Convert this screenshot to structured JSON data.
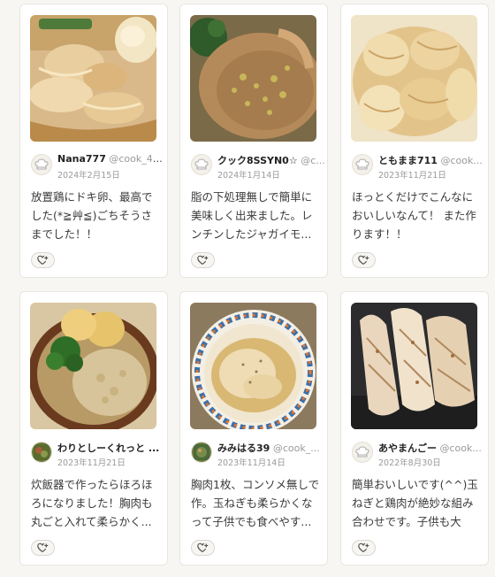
{
  "cards": [
    {
      "author": "Nana777",
      "cook_id": "@cook_40...",
      "date": "2024年2月15日",
      "comment": "放置鶏にドキ卵、最高でした(*≧艸≦)ごちそうさまでした！！",
      "avatar_icon": "chef-hat-icon",
      "photo": "chicken-with-egg"
    },
    {
      "author": "クック8SSYN0☆",
      "cook_id": "@c...",
      "date": "2024年1月14日",
      "comment": "脂の下処理無しで簡単に美味しく出来ました。レンチンしたジャガイモ...",
      "avatar_icon": "chef-hat-icon",
      "photo": "chicken-with-onion-sauce"
    },
    {
      "author": "ともまま711",
      "cook_id": "@cook...",
      "date": "2023年11月21日",
      "comment": "ほっとくだけでこんなにおいしいなんて！ また作ります！！",
      "avatar_icon": "chef-hat-icon",
      "photo": "sliced-chicken"
    },
    {
      "author": "わりとしーくれっと ...",
      "cook_id": "",
      "date": "2023年11月21日",
      "comment": "炊飯器で作ったらほろほろになりました！胸肉も丸ごと入れて柔らかく...",
      "avatar_icon": "user-photo-icon",
      "photo": "chicken-bowl-broccoli"
    },
    {
      "author": "みみはる39",
      "cook_id": "@cook_...",
      "date": "2023年11月14日",
      "comment": "胸肉1枚、コンソメ無しで作。玉ねぎも柔らかくなって子供でも食べやす...",
      "avatar_icon": "user-photo-icon",
      "photo": "chicken-in-broth-plate"
    },
    {
      "author": "あやまんごー",
      "cook_id": "@cook...",
      "date": "2022年8月30日",
      "comment": "簡単おいしいです(^^)玉ねぎと鶏肉が絶妙な組み合わせです。子供も大喜...",
      "avatar_icon": "chef-hat-icon",
      "photo": "grilled-chicken-pan"
    }
  ],
  "like_icon": "heart-plus-icon",
  "colors": {
    "card_bg": "#ffffff",
    "page_bg": "#f7f6f3",
    "text": "#333333",
    "muted": "#9a9a9a"
  }
}
